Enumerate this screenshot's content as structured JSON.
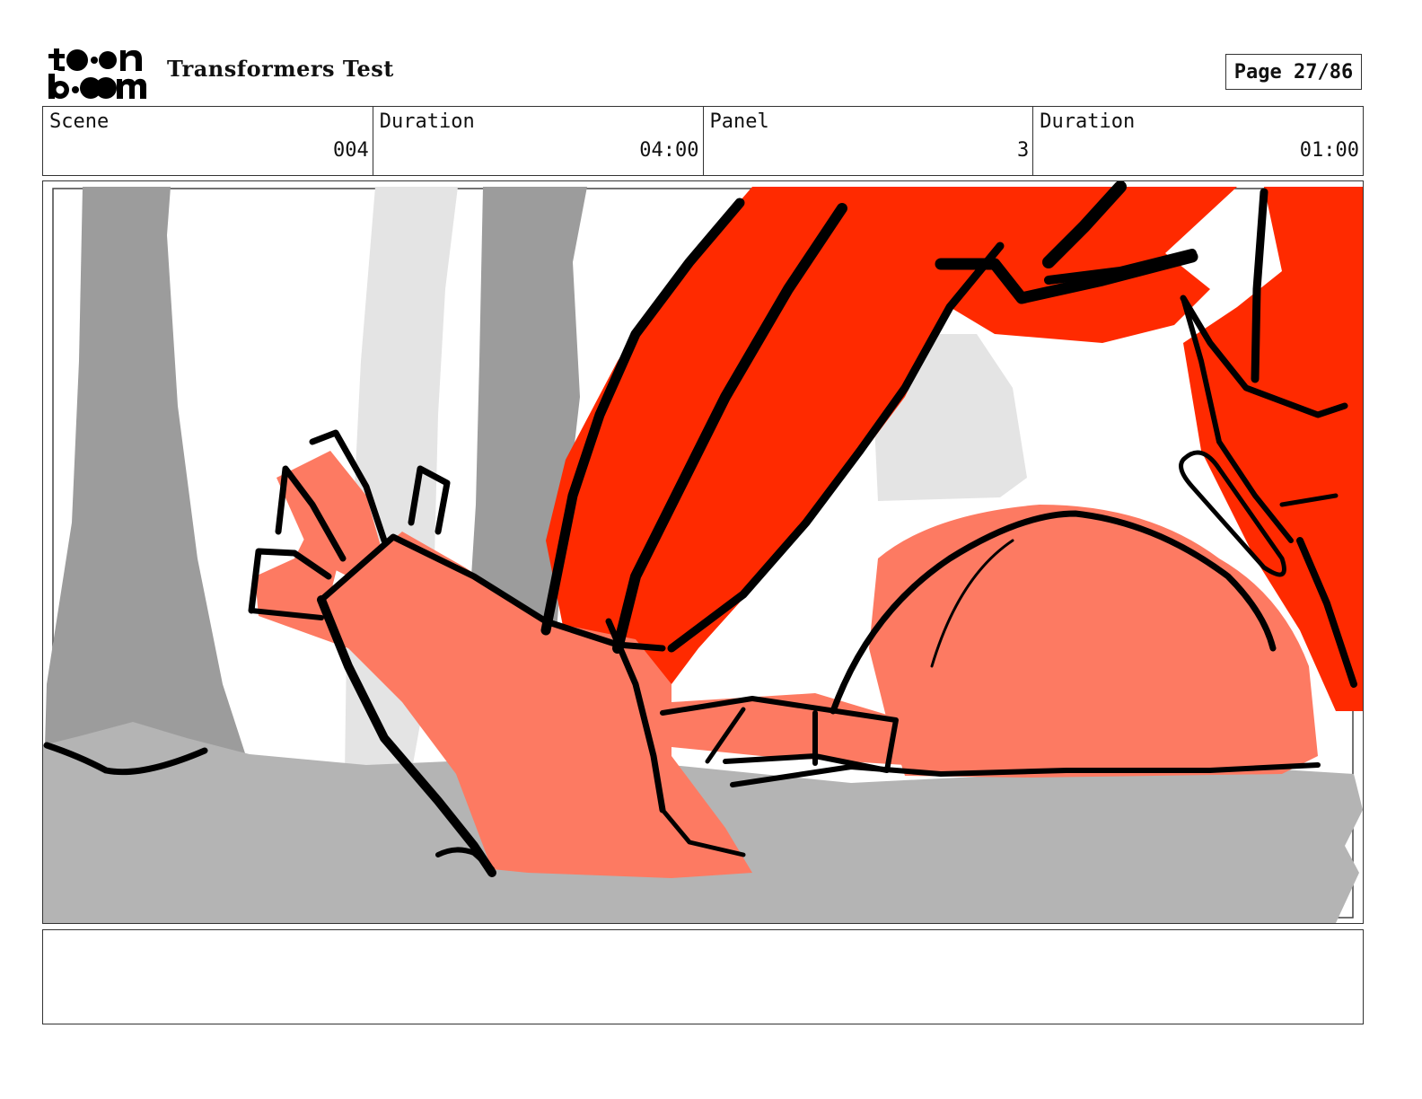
{
  "header": {
    "logo_text": "toon boom",
    "project_title": "Transformers Test",
    "page_label": "Page 27/86"
  },
  "info": [
    {
      "label": "Scene",
      "value": "004"
    },
    {
      "label": "Duration",
      "value": "04:00"
    },
    {
      "label": "Panel",
      "value": "3"
    },
    {
      "label": "Duration",
      "value": "01:00"
    }
  ],
  "panel": {
    "illustration": "storyboard-sketch",
    "colors": {
      "red": "#ff2a00",
      "salmon": "#fd7a62",
      "gray_dark": "#9c9c9c",
      "gray_light": "#e4e4e4",
      "ground": "#b4b4b4",
      "ink": "#000000"
    }
  },
  "notes": {
    "text": ""
  }
}
